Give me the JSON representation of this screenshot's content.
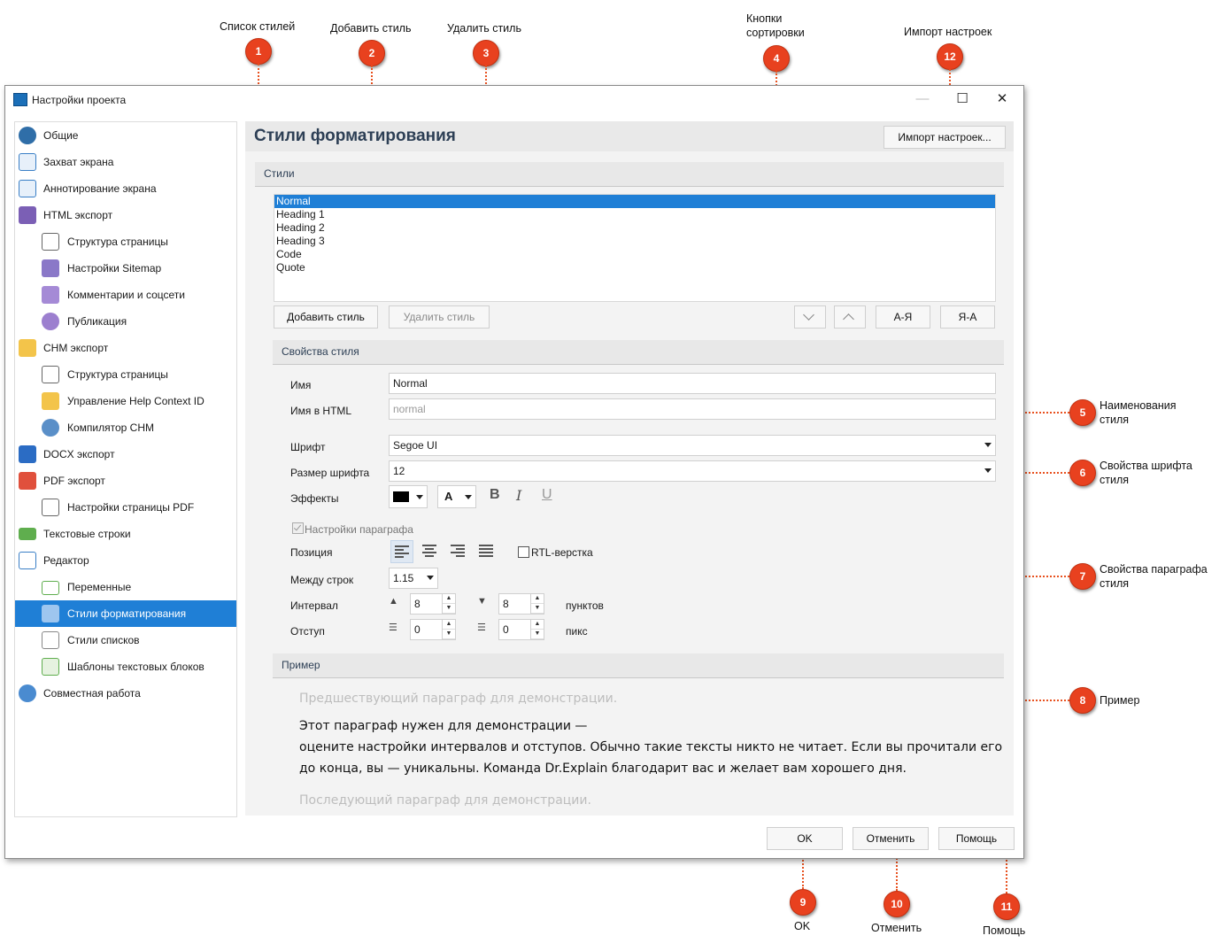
{
  "callouts": [
    {
      "num": "1",
      "label": "Список стилей"
    },
    {
      "num": "2",
      "label": "Добавить стиль"
    },
    {
      "num": "3",
      "label": "Удалить стиль"
    },
    {
      "num": "4",
      "label": "Кнопки сортировки"
    },
    {
      "num": "12",
      "label": "Импорт настроек"
    },
    {
      "num": "5",
      "label": "Наименования стиля"
    },
    {
      "num": "6",
      "label": "Свойства шрифта стиля"
    },
    {
      "num": "7",
      "label": "Свойства параграфа стиля"
    },
    {
      "num": "8",
      "label": "Пример"
    },
    {
      "num": "9",
      "label": "OK"
    },
    {
      "num": "10",
      "label": "Отменить"
    },
    {
      "num": "11",
      "label": "Помощь"
    }
  ],
  "window": {
    "title": "Настройки проекта",
    "minimize": "—",
    "maximize": "☐",
    "close": "✕"
  },
  "sidebar": {
    "items": [
      {
        "label": "Общие",
        "icon": "gear-icon"
      },
      {
        "label": "Захват экрана",
        "icon": "capture-icon"
      },
      {
        "label": "Аннотирование экрана",
        "icon": "annotate-icon"
      },
      {
        "label": "HTML экспорт",
        "icon": "html-icon"
      },
      {
        "label": "Структура страницы",
        "icon": "page-layout-icon"
      },
      {
        "label": "Настройки Sitemap",
        "icon": "sitemap-icon"
      },
      {
        "label": "Комментарии и соцсети",
        "icon": "comments-icon"
      },
      {
        "label": "Публикация",
        "icon": "cloud-icon"
      },
      {
        "label": "CHM экспорт",
        "icon": "chm-icon"
      },
      {
        "label": "Структура страницы",
        "icon": "page-layout-icon"
      },
      {
        "label": "Управление Help Context ID",
        "icon": "id-icon"
      },
      {
        "label": "Компилятор CHM",
        "icon": "gears-icon"
      },
      {
        "label": "DOCX экспорт",
        "icon": "word-icon"
      },
      {
        "label": "PDF экспорт",
        "icon": "pdf-icon"
      },
      {
        "label": "Настройки страницы PDF",
        "icon": "page-layout-icon"
      },
      {
        "label": "Текстовые строки",
        "icon": "text-strings-icon"
      },
      {
        "label": "Редактор",
        "icon": "editor-icon"
      },
      {
        "label": "Переменные",
        "icon": "variables-icon"
      },
      {
        "label": "Стили форматирования",
        "icon": "styles-icon"
      },
      {
        "label": "Стили списков",
        "icon": "list-styles-icon"
      },
      {
        "label": "Шаблоны текстовых блоков",
        "icon": "templates-icon"
      },
      {
        "label": "Совместная работа",
        "icon": "team-icon"
      }
    ]
  },
  "main": {
    "title": "Стили форматирования",
    "import_button": "Импорт настроек...",
    "styles_section": "Стили",
    "styles_list": [
      "Normal",
      "Heading 1",
      "Heading 2",
      "Heading 3",
      "Code",
      "Quote"
    ],
    "add_button": "Добавить стиль",
    "delete_button": "Удалить стиль",
    "sort_az": "А-Я",
    "sort_za": "Я-А",
    "props_section": "Свойства стиля",
    "name_label": "Имя",
    "name_value": "Normal",
    "html_name_label": "Имя в HTML",
    "html_name_placeholder": "normal",
    "font_label": "Шрифт",
    "font_value": "Segoe UI",
    "font_size_label": "Размер шрифта",
    "font_size_value": "12",
    "effects_label": "Эффекты",
    "text_color": "#000000",
    "bold": "B",
    "italic": "I",
    "underline": "U",
    "highlight_glyph": "A",
    "paragraph_checkbox": "Настройки параграфа",
    "position_label": "Позиция",
    "rtl_label": "RTL-верстка",
    "line_spacing_label": "Между строк",
    "line_spacing_value": "1.15",
    "interval_label": "Интервал",
    "space_before": "8",
    "space_after": "8",
    "interval_unit": "пунктов",
    "indent_label": "Отступ",
    "indent_left": "0",
    "indent_first": "0",
    "indent_unit": "пикс",
    "example_section": "Пример",
    "example_prev": "Предшествующий параграф для демонстрации.",
    "example_line1": "Этот параграф нужен для демонстрации —",
    "example_line2": "оцените настройки интервалов и отступов. Обычно такие тексты никто не читает. Если вы прочитали его",
    "example_line3": "до конца, вы — уникальны. Команда Dr.Explain благодарит вас и желает вам хорошего дня.",
    "example_next": "Последующий параграф для демонстрации."
  },
  "footer": {
    "ok": "OK",
    "cancel": "Отменить",
    "help": "Помощь"
  },
  "colors": {
    "accent": "#1f7fd6",
    "badge": "#e8411f",
    "leader": "#e8511f"
  }
}
